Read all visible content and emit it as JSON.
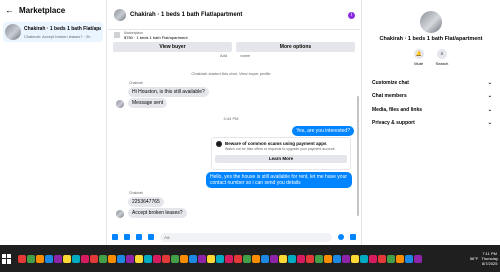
{
  "sidebar": {
    "back_glyph": "←",
    "title": "Marketplace",
    "conversation": {
      "name": "Chakirah · 1 beds 1 bath Flat/apartment",
      "preview": "Chakirah: Accept broken leases? · 2h"
    }
  },
  "chat": {
    "title": "Chakirah · 1 beds 1 bath Flat/apartment",
    "info_glyph": "i",
    "listing_label": "Marketplace",
    "listing_value": "$750 · 1 beds 1 bath Flat/apartment",
    "view_buyer": "View buyer",
    "more_options": "More options",
    "top_fragment_1": "Add",
    "top_fragment_2": "name",
    "system_started": "Chakirah started this chat. View buyer profile",
    "sender_name_1": "Chakirah",
    "msg_in_1": "Hi Houston, is this still available?",
    "msg_in_2": "Message sent",
    "msg_out_1": "Yes, are you interested?",
    "time_stamp": "4:44 PM",
    "scam_title": "Beware of common scams using payment apps",
    "scam_sub": "Watch out for fake offers or requests to upgrade your payment account.",
    "learn_more": "Learn More",
    "msg_out_2": "Hello, yes the house is still available for rent, let me have your contact number so i can send you details",
    "sender_name_2": "Chakirah",
    "msg_in_3": "2253647765",
    "msg_in_4": "Accept broken leases?",
    "composer_placeholder": "Aa"
  },
  "details": {
    "name": "Chakirah · 1 beds 1 bath Flat/apartment",
    "mute_label": "Mute",
    "search_label": "Search",
    "menu": [
      {
        "label": "Customize chat"
      },
      {
        "label": "Chat members"
      },
      {
        "label": "Media, files and links"
      },
      {
        "label": "Privacy & support"
      }
    ],
    "chevron": "⌄"
  },
  "taskbar": {
    "weather": "56°F",
    "time": "7:11 PM",
    "day": "Thursday",
    "date": "8/7/2025",
    "app_colors": [
      "#e53935",
      "#43a047",
      "#fb8c00",
      "#1e88e5",
      "#8e24aa",
      "#fdd835",
      "#00acc1",
      "#d81b60"
    ]
  }
}
